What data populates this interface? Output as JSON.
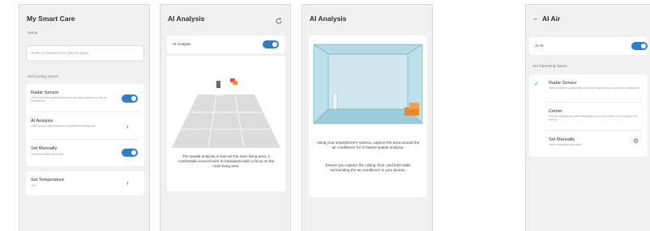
{
  "screen1": {
    "title": "My Smart Care",
    "name_label": "Name",
    "name_placeholder": "Enter a nickname for (device type)",
    "section_label": "Set Cooling Space",
    "items": [
      {
        "label": "Radar Sensor",
        "desc": "Uses real-time spatial data from the radar sensor on the air conditioner",
        "control": "toggle",
        "state": "on"
      },
      {
        "label": "AI Analysis",
        "desc": "Uses preset data analyzed by artificial intelligence",
        "control": "chevron"
      },
      {
        "label": "Set Manually",
        "desc": "Uses manually input data",
        "control": "toggle",
        "state": "on"
      }
    ],
    "temp_label": "Set Temperature",
    "temp_value": "18°C",
    "icon": "chevron-right-icon"
  },
  "screen2": {
    "title": "AI Analysis",
    "refresh_icon": "refresh-icon",
    "toggle_label": "AI Analysis",
    "toggle_state": "on",
    "description": "The spatial analysis AI has set the main living area. A comfortable environment is maintained with a focus on the main living area."
  },
  "screen3": {
    "title": "AI Analysis",
    "para1": "Using your smartphone's camera, capture the area around the air conditioner for AI-based spatial analysis.",
    "para2": "Ensure you capture the ceiling, floor, and both walls surrounding the air conditioner in your photos."
  },
  "screen4": {
    "back_icon": "back-arrow-icon",
    "title": "AI Air",
    "toggle_label": "AI Air",
    "toggle_state": "on",
    "section_label": "Set Operating Space",
    "options": [
      {
        "label": "Radar Sensor",
        "desc": "Uses real-time spatial data from the radar sensor on the air conditioner",
        "selected": true
      },
      {
        "label": "Center",
        "desc": "The air conditioner uses information from the center of the space it is facing",
        "selected": false
      },
      {
        "label": "Set Manually",
        "desc": "Uses manually input data",
        "selected": false
      }
    ],
    "check_icon": "check-icon",
    "settings_icon": "gear-icon"
  },
  "colors": {
    "accent": "#2f7fc0",
    "background": "#f1f1f1",
    "card": "#ffffff",
    "room_wall": "#cfe7ee",
    "room_frame": "#7fb6c6",
    "sofa": "#e9872f"
  }
}
